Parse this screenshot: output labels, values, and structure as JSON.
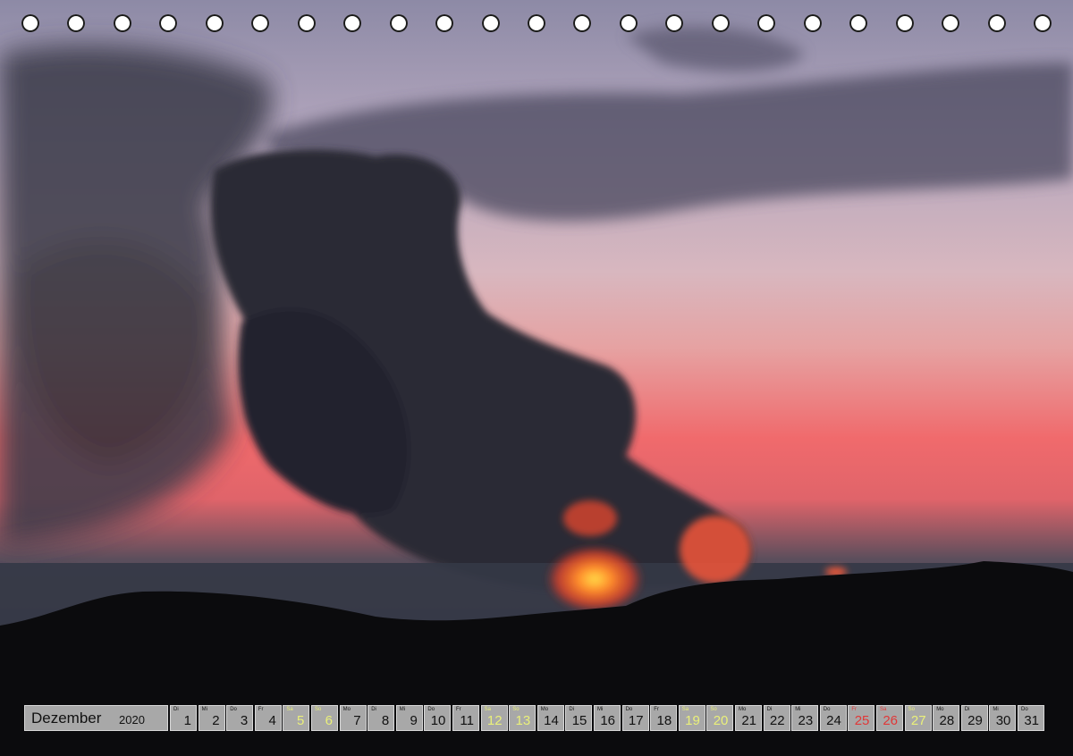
{
  "calendar": {
    "month": "Dezember",
    "year": "2020",
    "days": [
      {
        "n": "1",
        "wd": "Di",
        "type": "normal"
      },
      {
        "n": "2",
        "wd": "Mi",
        "type": "normal"
      },
      {
        "n": "3",
        "wd": "Do",
        "type": "normal"
      },
      {
        "n": "4",
        "wd": "Fr",
        "type": "normal"
      },
      {
        "n": "5",
        "wd": "Sa",
        "type": "weekend"
      },
      {
        "n": "6",
        "wd": "So",
        "type": "weekend"
      },
      {
        "n": "7",
        "wd": "Mo",
        "type": "normal"
      },
      {
        "n": "8",
        "wd": "Di",
        "type": "normal"
      },
      {
        "n": "9",
        "wd": "Mi",
        "type": "normal"
      },
      {
        "n": "10",
        "wd": "Do",
        "type": "normal"
      },
      {
        "n": "11",
        "wd": "Fr",
        "type": "normal"
      },
      {
        "n": "12",
        "wd": "Sa",
        "type": "weekend"
      },
      {
        "n": "13",
        "wd": "So",
        "type": "weekend"
      },
      {
        "n": "14",
        "wd": "Mo",
        "type": "normal"
      },
      {
        "n": "15",
        "wd": "Di",
        "type": "normal"
      },
      {
        "n": "16",
        "wd": "Mi",
        "type": "normal"
      },
      {
        "n": "17",
        "wd": "Do",
        "type": "normal"
      },
      {
        "n": "18",
        "wd": "Fr",
        "type": "normal"
      },
      {
        "n": "19",
        "wd": "Sa",
        "type": "weekend"
      },
      {
        "n": "20",
        "wd": "So",
        "type": "weekend"
      },
      {
        "n": "21",
        "wd": "Mo",
        "type": "normal"
      },
      {
        "n": "22",
        "wd": "Di",
        "type": "normal"
      },
      {
        "n": "23",
        "wd": "Mi",
        "type": "normal"
      },
      {
        "n": "24",
        "wd": "Do",
        "type": "normal"
      },
      {
        "n": "25",
        "wd": "Fr",
        "type": "holiday"
      },
      {
        "n": "26",
        "wd": "Sa",
        "type": "holiday"
      },
      {
        "n": "27",
        "wd": "So",
        "type": "weekend"
      },
      {
        "n": "28",
        "wd": "Mo",
        "type": "normal"
      },
      {
        "n": "29",
        "wd": "Di",
        "type": "normal"
      },
      {
        "n": "30",
        "wd": "Mi",
        "type": "normal"
      },
      {
        "n": "31",
        "wd": "Do",
        "type": "normal"
      }
    ]
  },
  "colors": {
    "weekend": "#eaf07a",
    "holiday": "#e03838",
    "cell": "#a8a8a8"
  }
}
